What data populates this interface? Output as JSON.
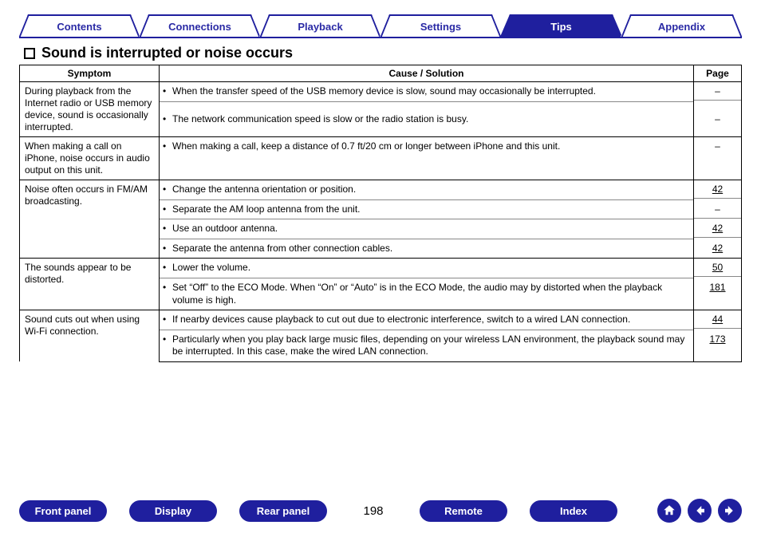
{
  "tabs": [
    {
      "label": "Contents",
      "active": false
    },
    {
      "label": "Connections",
      "active": false
    },
    {
      "label": "Playback",
      "active": false
    },
    {
      "label": "Settings",
      "active": false
    },
    {
      "label": "Tips",
      "active": true
    },
    {
      "label": "Appendix",
      "active": false
    }
  ],
  "heading": "Sound is interrupted or noise occurs",
  "table": {
    "headers": {
      "symptom": "Symptom",
      "cause": "Cause / Solution",
      "page": "Page"
    },
    "groups": [
      {
        "symptom": "During playback from the Internet radio or USB memory device, sound is occasionally interrupted.",
        "rows": [
          {
            "cause": "When the transfer speed of the USB memory device is slow, sound may occasionally be interrupted.",
            "page": "–"
          },
          {
            "cause": "The network communication speed is slow or the radio station is busy.",
            "page": "–"
          }
        ]
      },
      {
        "symptom": "When making a call on iPhone, noise occurs in audio output on this unit.",
        "rows": [
          {
            "cause": "When making a call, keep a distance of 0.7 ft/20 cm or longer between iPhone and this unit.",
            "page": "–"
          }
        ]
      },
      {
        "symptom": "Noise often occurs in FM/AM broadcasting.",
        "rows": [
          {
            "cause": "Change the antenna orientation or position.",
            "page": "42"
          },
          {
            "cause": "Separate the AM loop antenna from the unit.",
            "page": "–"
          },
          {
            "cause": "Use an outdoor antenna.",
            "page": "42"
          },
          {
            "cause": "Separate the antenna from other connection cables.",
            "page": "42"
          }
        ]
      },
      {
        "symptom": "The sounds appear to be distorted.",
        "rows": [
          {
            "cause": "Lower the volume.",
            "page": "50"
          },
          {
            "cause": "Set “Off” to the ECO Mode. When “On” or “Auto” is in the ECO Mode, the audio may by distorted when the playback volume is high.",
            "page": "181"
          }
        ]
      },
      {
        "symptom": "Sound cuts out when using Wi-Fi connection.",
        "rows": [
          {
            "cause": "If nearby devices cause playback to cut out due to electronic interference, switch to a wired LAN connection.",
            "page": "44"
          },
          {
            "cause": "Particularly when you play back large music files, depending on your wireless LAN environment, the playback sound may be interrupted. In this case, make the wired LAN connection.",
            "page": "173"
          }
        ]
      }
    ]
  },
  "footer": {
    "buttons": [
      "Front panel",
      "Display",
      "Rear panel"
    ],
    "page_number": "198",
    "buttons2": [
      "Remote",
      "Index"
    ]
  },
  "icons": {
    "home": "home-icon",
    "prev": "arrow-left-icon",
    "next": "arrow-right-icon"
  }
}
